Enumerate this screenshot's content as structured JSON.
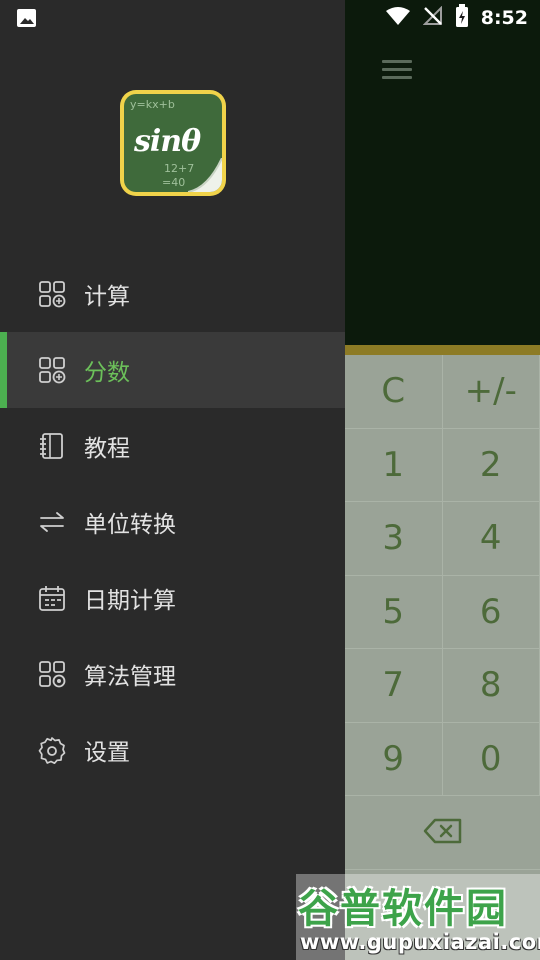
{
  "status_bar": {
    "time": "8:52"
  },
  "drawer": {
    "logo": {
      "text": "sinθ",
      "scribble_top": "y=kx+b",
      "scribble_mid": "12+7",
      "scribble_bottom": "=40"
    },
    "items": [
      {
        "label": "计算",
        "icon": "grid-plus-icon",
        "active": false
      },
      {
        "label": "分数",
        "icon": "grid-plus-icon",
        "active": true
      },
      {
        "label": "教程",
        "icon": "notebook-icon",
        "active": false
      },
      {
        "label": "单位转换",
        "icon": "swap-icon",
        "active": false
      },
      {
        "label": "日期计算",
        "icon": "calendar-icon",
        "active": false
      },
      {
        "label": "算法管理",
        "icon": "grid-target-icon",
        "active": false
      },
      {
        "label": "设置",
        "icon": "gear-icon",
        "active": false
      }
    ],
    "active_color": "#4caf50"
  },
  "calculator": {
    "keys": [
      [
        "C",
        "+/-"
      ],
      [
        "1",
        "2"
      ],
      [
        "3",
        "4"
      ],
      [
        "5",
        "6"
      ],
      [
        "7",
        "8"
      ],
      [
        "9",
        "0"
      ]
    ],
    "backspace_icon": "backspace-icon"
  },
  "watermark": {
    "title": "谷普软件园",
    "url": "www.gupuxiazai.com"
  }
}
